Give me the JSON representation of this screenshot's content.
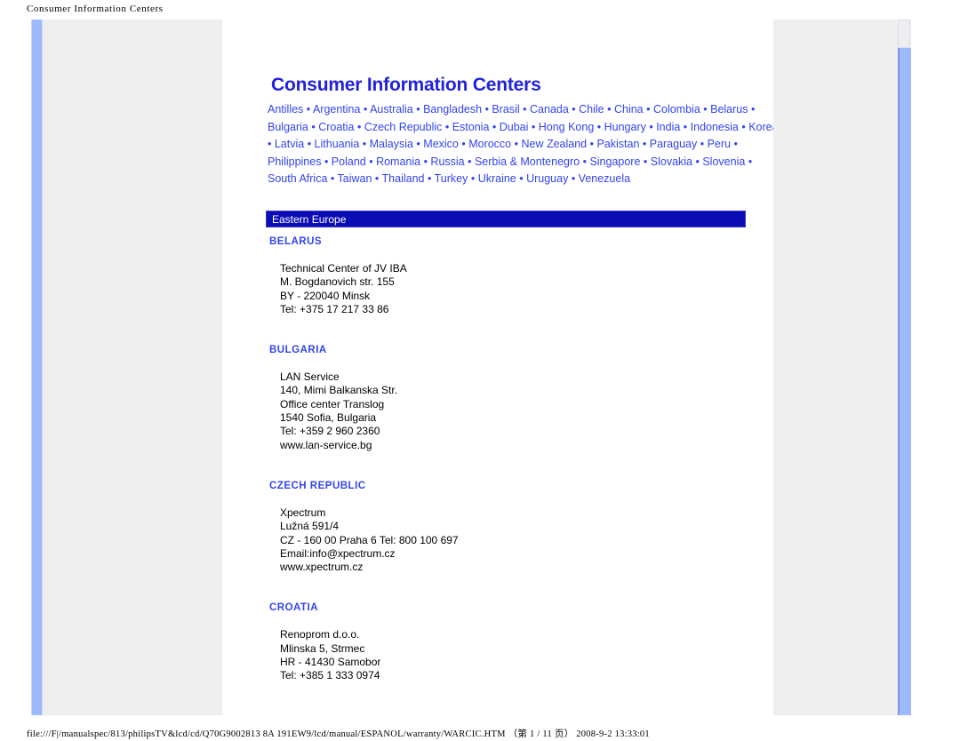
{
  "print": {
    "header_title": "Consumer Information Centers",
    "footer_path": "file:///F|/manualspec/813/philipsTV&lcd/cd/Q70G9002813 8A 191EW9/lcd/manual/ESPANOL/warranty/WARCIC.HTM",
    "footer_page": "（第 1 / 11 页）",
    "footer_timestamp": "2008-9-2 13:33:01"
  },
  "document": {
    "title": "Consumer Information Centers",
    "separator": "•",
    "countries": [
      "Antilles",
      "Argentina",
      "Australia",
      "Bangladesh",
      "Brasil",
      "Canada",
      "Chile",
      "China",
      "Colombia",
      "Belarus",
      "Bulgaria",
      "Croatia",
      "Czech Republic",
      "Estonia",
      "Dubai",
      " Hong Kong",
      "Hungary",
      "India",
      "Indonesia",
      "Korea",
      "Latvia",
      "Lithuania",
      "Malaysia",
      "Mexico",
      "Morocco",
      "New Zealand",
      "Pakistan",
      "Paraguay",
      "Peru",
      "Philippines",
      "Poland",
      "Romania",
      "Russia",
      "Serbia & Montenegro",
      "Singapore",
      "Slovakia",
      "Slovenia",
      "South Africa",
      "Taiwan",
      "Thailand",
      "Turkey",
      "Ukraine",
      "Uruguay",
      "Venezuela"
    ],
    "region_heading": "Eastern Europe",
    "entries": [
      {
        "country": "BELARUS",
        "lines": [
          "Technical Center of JV IBA",
          "M. Bogdanovich str. 155",
          "BY - 220040 Minsk",
          "Tel: +375 17 217 33 86"
        ]
      },
      {
        "country": "BULGARIA",
        "lines": [
          "LAN Service",
          "140, Mimi Balkanska Str.",
          "Office center Translog",
          "1540 Sofia, Bulgaria",
          "Tel: +359 2 960 2360",
          "www.lan-service.bg"
        ]
      },
      {
        "country": "CZECH REPUBLIC",
        "lines": [
          "Xpectrum",
          "Lužná 591/4",
          "CZ - 160 00 Praha 6 Tel: 800 100 697",
          "Email:info@xpectrum.cz",
          "www.xpectrum.cz"
        ]
      },
      {
        "country": "CROATIA",
        "lines": [
          "Renoprom d.o.o.",
          "Mlinska 5, Strmec",
          "HR - 41430 Samobor",
          "Tel: +385 1 333 0974"
        ]
      }
    ]
  },
  "colors": {
    "link": "#3344ee",
    "title": "#2222dd",
    "region_bar": "#0c0cb4",
    "panel": "#efefef",
    "scrollbar_thumb": "#9dbaff"
  }
}
